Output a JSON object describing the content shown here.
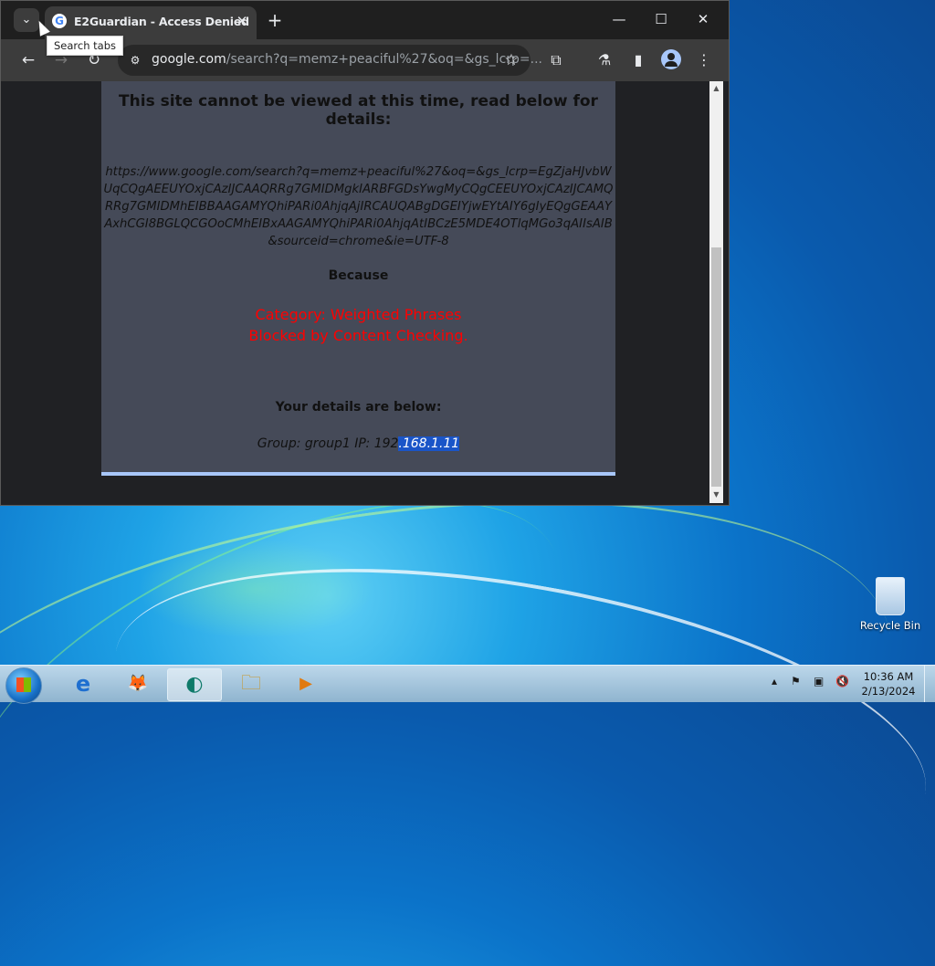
{
  "browser": {
    "tab_title": "E2Guardian - Access Denied",
    "tab_favicon": "G",
    "tooltip": "Search tabs",
    "url_host": "google.com",
    "url_rest": "/search?q=memz+peaciful%27&oq=&gs_lcrp=...",
    "icons": {
      "tab_search": "⌄",
      "close": "✕",
      "new_tab": "+",
      "minimize": "—",
      "maximize": "☐",
      "window_close": "✕",
      "back": "←",
      "forward": "→",
      "reload": "↻",
      "site_info": "⚙",
      "star": "☆",
      "extensions": "⧉",
      "labs": "⚗",
      "side_panel": "▮",
      "menu": "⋮"
    }
  },
  "page": {
    "heading": "This site cannot be viewed at this time, read below for details:",
    "blocked_url": "https://www.google.com/search?q=memz+peaciful%27&oq=&gs_lcrp=EgZjaHJvbWUqCQgAEEUYOxjCAzIJCAAQRRg7GMIDMgkIARBFGDsYwgMyCQgCEEUYOxjCAzIJCAMQRRg7GMIDMhEIBBAAGAMYQhiPARi0AhjqAjIRCAUQABgDGEIYjwEYtAIY6gIyEQgGEAAYAxhCGI8BGLQCGOoCMhEIBxAAGAMYQhiPARi0AhjqAtIBCzE5MDE4OTlqMGo3qAIIsAIB&sourceid=chrome&ie=UTF-8",
    "because": "Because",
    "category_line": "Category: Weighted Phrases",
    "blocked_line": "Blocked by Content Checking.",
    "details_title": "Your details are below:",
    "details_prefix": "Group: group1   IP: 192",
    "details_selected": ".168.1.11"
  },
  "desktop": {
    "recycle_bin_label": "Recycle Bin"
  },
  "taskbar": {
    "apps": [
      "internet-explorer",
      "firefox",
      "edge",
      "file-explorer",
      "media-player"
    ],
    "app_glyphs": [
      "e",
      "🦊",
      "◐",
      "🗀",
      "▶"
    ],
    "tray_icons": [
      "▴",
      "⚑",
      "▣",
      "🔇"
    ],
    "time": "10:36 AM",
    "date": "2/13/2024"
  },
  "colors": {
    "blocked_text": "#ff0000",
    "selection": "#1a55c8",
    "panel_bg": "#454a58"
  }
}
